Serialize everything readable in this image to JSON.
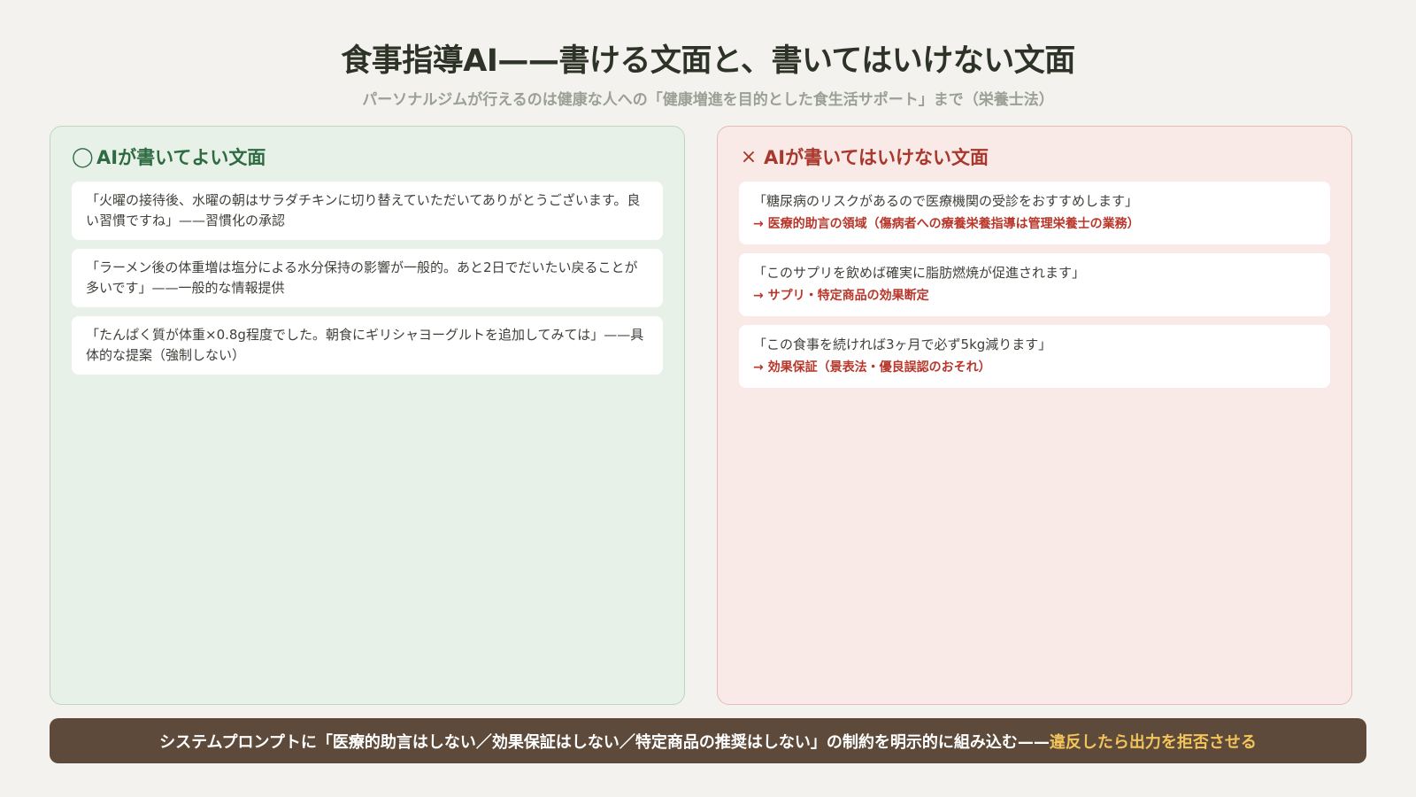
{
  "header": {
    "title": "食事指導AI——書ける文面と、書いてはいけない文面",
    "subtitle": "パーソナルジムが行えるのは健康な人への「健康増進を目的とした食生活サポート」まで（栄養士法）"
  },
  "good_panel": {
    "icon": "circle-ok-icon",
    "mark": "◯",
    "heading": "AIが書いてよい文面",
    "color": "#2e6b42",
    "cards": [
      {
        "text": "「火曜の接待後、水曜の朝はサラダチキンに切り替えていただいてありがとうございます。良い習慣ですね」——習慣化の承認"
      },
      {
        "text": "「ラーメン後の体重増は塩分による水分保持の影響が一般的。あと2日でだいたい戻ることが多いです」——一般的な情報提供"
      },
      {
        "text": "「たんぱく質が体重×0.8g程度でした。朝食にギリシャヨーグルトを追加してみては」——具体的な提案（強制しない）"
      }
    ]
  },
  "bad_panel": {
    "icon": "cross-ng-icon",
    "mark": "×",
    "heading": "AIが書いてはいけない文面",
    "color": "#a8372c",
    "cards": [
      {
        "text": "「糖尿病のリスクがあるので医療機関の受診をおすすめします」",
        "note": "→ 医療的助言の領域（傷病者への療養栄養指導は管理栄養士の業務）"
      },
      {
        "text": "「このサプリを飲めば確実に脂肪燃焼が促進されます」",
        "note": "→ サプリ・特定商品の効果断定"
      },
      {
        "text": "「この食事を続ければ3ヶ月で必ず5kg減ります」",
        "note": "→ 効果保証（景表法・優良誤認のおそれ）"
      }
    ]
  },
  "footer": {
    "text": "システムプロンプトに「医療的助言はしない／効果保証はしない／特定商品の推奨はしない」の制約を明示的に組み込む——",
    "highlight": "違反したら出力を拒否させる",
    "background": "#5d4a3a",
    "highlight_color": "#f2c45a"
  }
}
